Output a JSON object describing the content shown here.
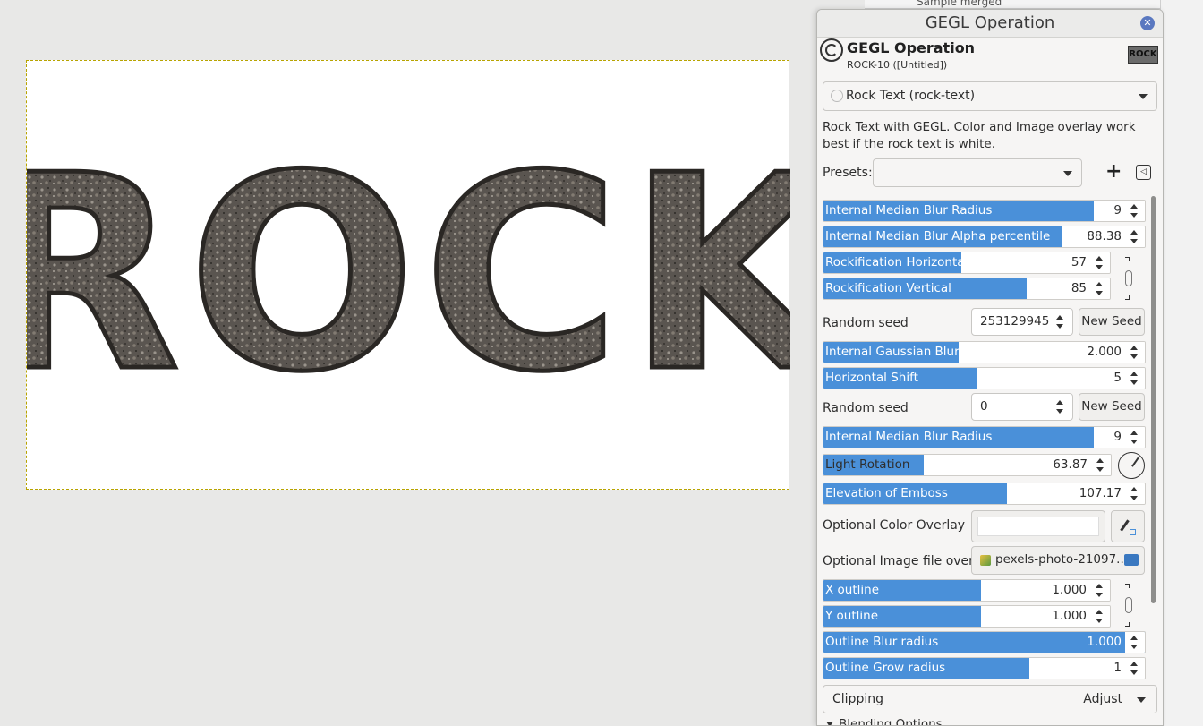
{
  "canvas": {
    "image_text": "ROCK"
  },
  "background": {
    "top_strip_label": "Sample merged",
    "right_strip_text": "ROCK"
  },
  "dialog": {
    "window_title": "GEGL Operation",
    "header_title": "GEGL Operation",
    "header_subtitle": "ROCK-10 ([Untitled])",
    "thumbnail_text": "ROCK",
    "operation": "Rock Text (rock-text)",
    "description": "Rock Text with GEGL. Color and Image overlay work best if the rock text is white.",
    "presets_label": "Presets:",
    "presets_value": "",
    "params": {
      "p1_label": "Internal Median Blur Radius",
      "p1_value": "9",
      "p1_fill": 0.84,
      "p2_label": "Internal Median Blur Alpha percentile",
      "p2_value": "88.38",
      "p2_fill": 0.74,
      "p3_label": "Rockification Horizontal",
      "p3_value": "57",
      "p3_fill": 0.48,
      "p4_label": "Rockification Vertical",
      "p4_value": "85",
      "p4_fill": 0.71,
      "seed1_label": "Random seed",
      "seed1_value": "253129945",
      "seed1_button": "New Seed",
      "p5_label": "Internal Gaussian Blur",
      "p5_value": "2.000",
      "p5_fill": 0.42,
      "p6_label": "Horizontal Shift",
      "p6_value": "5",
      "p6_fill": 0.48,
      "seed2_label": "Random seed",
      "seed2_value": "0",
      "seed2_button": "New Seed",
      "p7_label": "Internal Median Blur Radius",
      "p7_value": "9",
      "p7_fill": 0.84,
      "p8_label": "Light Rotation",
      "p8_value": "63.87",
      "p8_fill": 0.35,
      "p9_label": "Elevation of Emboss",
      "p9_value": "107.17",
      "p9_fill": 0.57,
      "color_overlay_label": "Optional Color Overlay",
      "image_overlay_label": "Optional Image file overlay",
      "image_overlay_file": "pexels-photo-21097...",
      "p10_label": "X outline",
      "p10_value": "1.000",
      "p10_fill": 0.55,
      "p11_label": "Y outline",
      "p11_value": "1.000",
      "p11_fill": 0.55,
      "p12_label": "Outline Blur radius",
      "p12_value": "1.000",
      "p12_fill": 1.0,
      "p13_label": "Outline Grow radius",
      "p13_value": "1",
      "p13_fill": 0.64
    },
    "clipping_label": "Clipping",
    "clipping_value": "Adjust",
    "blending_label": "Blending Options"
  },
  "colors": {
    "accent": "#4a90d9",
    "selection_border": "#b8a400"
  }
}
